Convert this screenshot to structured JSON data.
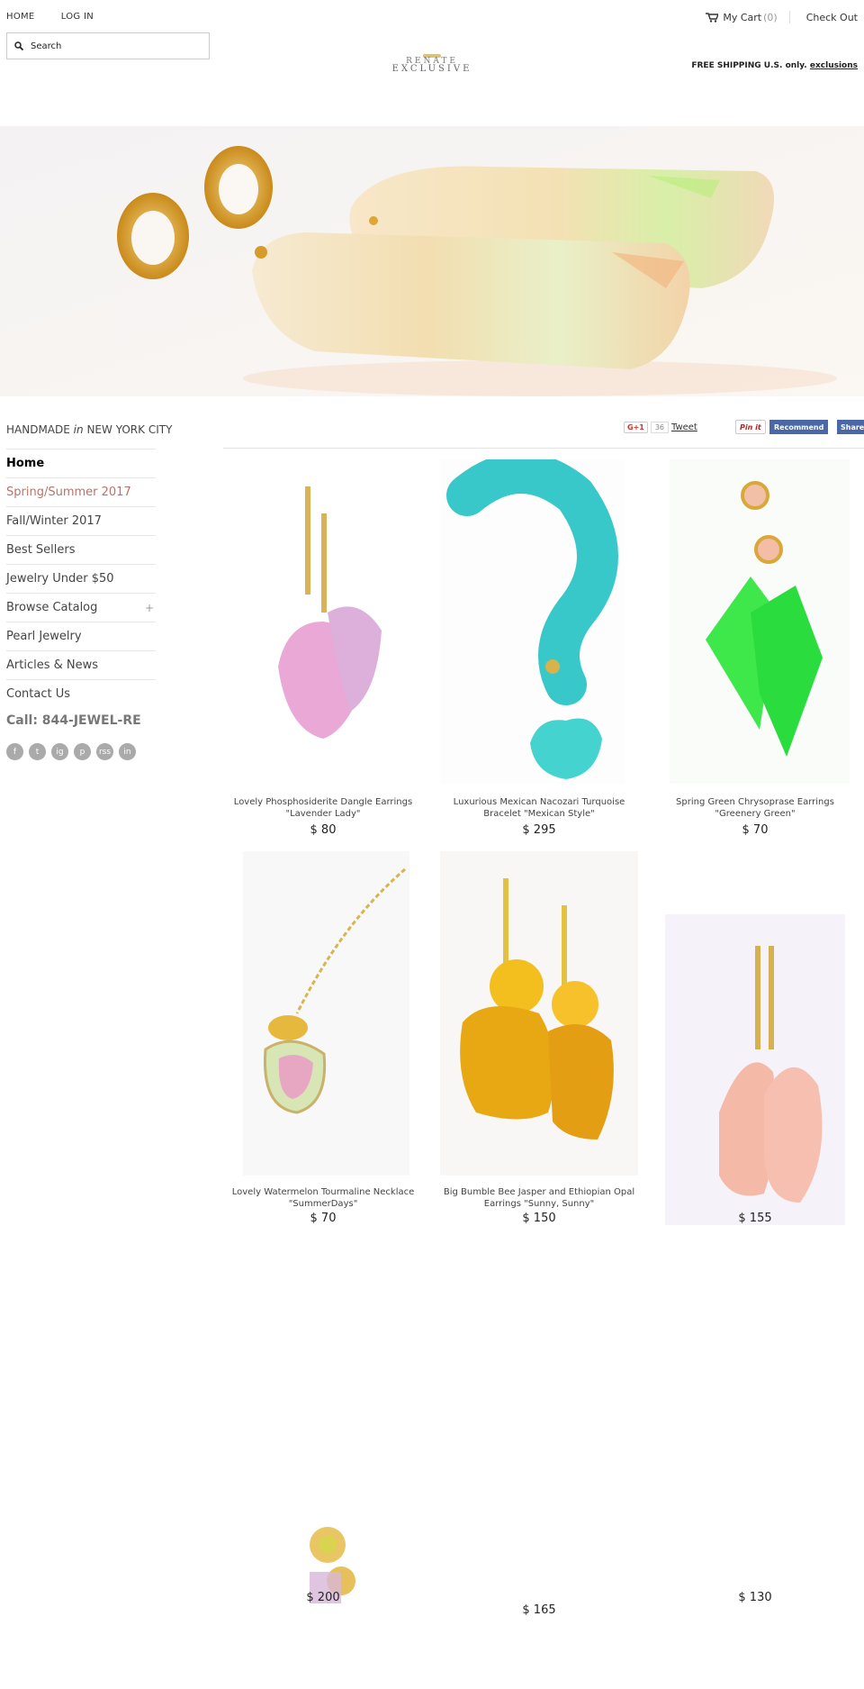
{
  "topbar": {
    "home": "HOME",
    "login": "LOG IN",
    "cart_label": "My Cart",
    "cart_count": "(0)",
    "checkout": "Check Out"
  },
  "search": {
    "placeholder": "Search"
  },
  "logo": {
    "line1": "RENATE",
    "line2": "EXCLUSIVE"
  },
  "shipping": {
    "text": "FREE SHIPPING U.S. only.",
    "link": "exclusions"
  },
  "tagline": {
    "pre": "HANDMADE",
    "mid": "in",
    "post": "NEW YORK CITY"
  },
  "social": {
    "gplus": "G+1",
    "gplus_count": "36",
    "tweet": "Tweet",
    "pin": "Pin it",
    "fb_recommend": "Recommend",
    "fb_share": "Share"
  },
  "nav": {
    "items": [
      {
        "label": "Home"
      },
      {
        "label": "Spring/Summer 2017"
      },
      {
        "label": "Fall/Winter 2017"
      },
      {
        "label": "Best Sellers"
      },
      {
        "label": "Jewelry Under $50"
      },
      {
        "label": "Browse Catalog",
        "expand": "+"
      },
      {
        "label": "Pearl Jewelry"
      },
      {
        "label": "Articles & News"
      },
      {
        "label": "Contact Us"
      }
    ],
    "call": "Call: 844-JEWEL-RE",
    "social_icons": [
      "f",
      "t",
      "ig",
      "p",
      "rss",
      "in"
    ]
  },
  "products": [
    {
      "title": "Lovely Phosphosiderite Dangle Earrings \"Lavender Lady\"",
      "price": "$ 80"
    },
    {
      "title": "Luxurious Mexican Nacozari Turquoise Bracelet \"Mexican Style\"",
      "price": "$ 295"
    },
    {
      "title": "Spring Green Chrysoprase Earrings \"Greenery Green\"",
      "price": "$ 70"
    },
    {
      "title": "Lovely Watermelon Tourmaline Necklace \"SummerDays\"",
      "price": "$ 70"
    },
    {
      "title": "Big Bumble Bee Jasper and Ethiopian Opal Earrings \"Sunny, Sunny\"",
      "price": "$ 150"
    },
    {
      "title": "",
      "price": "$ 155"
    },
    {
      "title": "",
      "price": "$ 200"
    },
    {
      "title": "",
      "price": "$ 165"
    },
    {
      "title": "",
      "price": "$ 130"
    }
  ]
}
